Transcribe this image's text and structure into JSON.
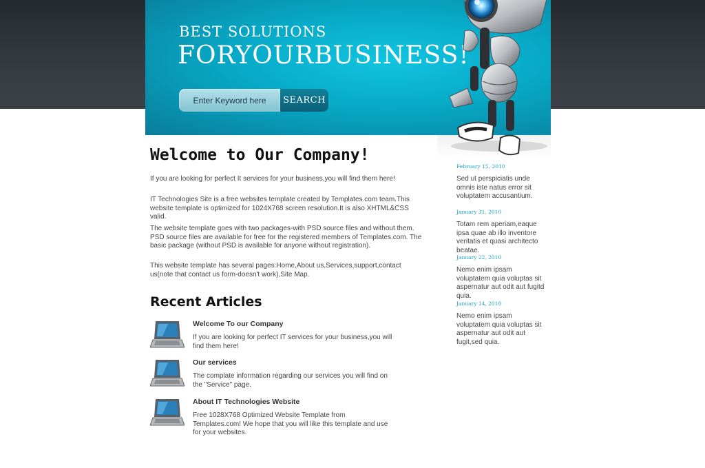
{
  "header": {
    "tagline_line1": "BEST SOLUTIONS",
    "tagline_line2": "FORYOURBUSINESS!",
    "search": {
      "placeholder": "Enter Keyword here",
      "button_label": "SEARCH"
    }
  },
  "main": {
    "welcome_title": "Welcome to Our Company!",
    "paragraphs": [
      "If you are looking for perfect It services for your business,you will find them here!",
      "IT Technologies Site is a free websites template created by Templates.com team.This website template is optimized for 1024X768 screen resolution.It is also XHTML&CSS valid.",
      "The website template goes with two packages-with PSD source files and without them. PSD source files are available for free for the registered members of Templates.com. The basic package (without PSD is available for anyone without registration).",
      "This website template has several pages:Home,About us,Services,support,contact us(note that contact us form-doesn't work),Site Map."
    ],
    "recent_title": "Recent Articles",
    "articles": [
      {
        "title": "Welcome To our Company",
        "text": "If you are looking for perfect IT services for your business,you will find them here!"
      },
      {
        "title": "Our services",
        "text": "The complate information regarding our services you will find on the \"Service\" page."
      },
      {
        "title": "About IT Technologies Website",
        "text": "Free 1028X768 Optimized Website Template from Templates.com! We hope that you will like this template and use for your websites."
      }
    ]
  },
  "sidebar": {
    "news": [
      {
        "date": "February 15, 2010",
        "text": "Sed ut perspiciatis unde omnis iste natus error sit voluptatem accusantium."
      },
      {
        "date": "January 31, 2010",
        "text": "Totam rem aperiam,eaque ipsa quae ab illo inventore veritatis et quasi architecto beatae."
      },
      {
        "date": "January 22, 2010",
        "text": "Nemo enim ipsam voluptatem quia voluptas sit aspernatur aut odit aut fugitd quia."
      },
      {
        "date": "January 14, 2010",
        "text": "Nemo enim ipsam voluptatem quia voluptas sit aspernatur aut odit aut fugit,sed quia."
      }
    ]
  },
  "colors": {
    "header_teal": "#07a9c7",
    "top_band_dark": "#343a40",
    "date_blue": "#1aa0c3",
    "search_button": "#0b5f76"
  },
  "icons": {
    "article_thumb": "laptop-icon",
    "mascot": "robot-illustration"
  }
}
